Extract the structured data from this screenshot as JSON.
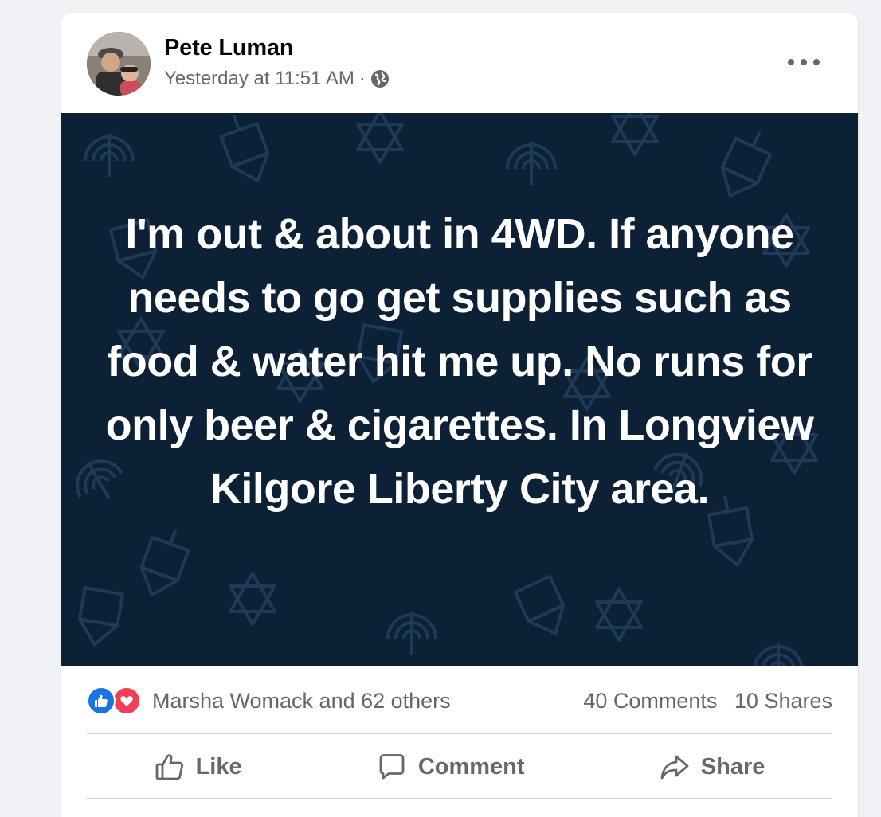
{
  "post": {
    "author": "Pete Luman",
    "timestamp": "Yesterday at 11:51 AM",
    "separator": "·",
    "privacy_icon": "globe-icon",
    "background_color": "#0c2036",
    "text": "I'm out & about in 4WD. If anyone needs to go get supplies such as food & water hit me up. No runs for only beer & cigarettes. In Longview Kilgore Liberty City area."
  },
  "stats": {
    "reactions_text": "Marsha Womack and 62 others",
    "reaction_icons": [
      "like-icon",
      "love-icon"
    ],
    "comments": "40 Comments",
    "shares": "10 Shares"
  },
  "actions": {
    "like": "Like",
    "comment": "Comment",
    "share": "Share"
  },
  "colors": {
    "like_blue": "#1b74e4",
    "love_red": "#f33e58",
    "secondary_text": "#65676b"
  }
}
